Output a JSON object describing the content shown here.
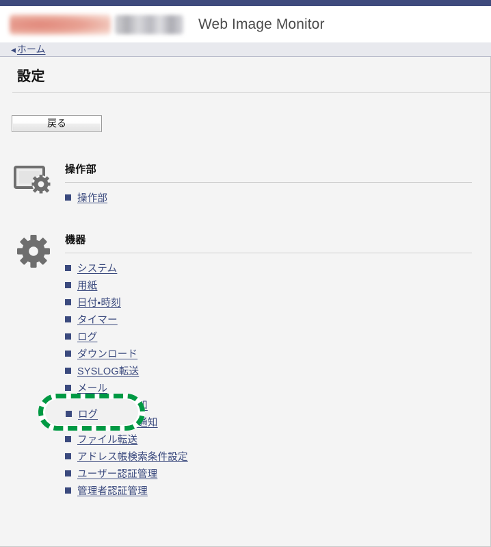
{
  "header": {
    "app_title": "Web Image Monitor",
    "logo_alt": "redacted-brand-logo",
    "topbar_color": "#3f4b7d"
  },
  "breadcrumb": {
    "arrow": "◀",
    "home_label": "ホーム"
  },
  "page": {
    "title": "設定"
  },
  "toolbar": {
    "back_label": "戻る"
  },
  "sections": [
    {
      "id": "operation-panel",
      "title": "操作部",
      "icon": "monitor-gear-icon",
      "items": [
        {
          "label": "操作部"
        }
      ]
    },
    {
      "id": "device",
      "title": "機器",
      "icon": "gear-icon",
      "items": [
        {
          "label": "システム"
        },
        {
          "label": "用紙"
        },
        {
          "label": "日付・時刻"
        },
        {
          "label": "タイマー",
          "obscured": true
        },
        {
          "label": "ログ",
          "highlighted": true
        },
        {
          "label": "ダウンロード",
          "obscured": true
        },
        {
          "label": "SYSLOG転送"
        },
        {
          "label": "メール"
        },
        {
          "label": "自動メール通知"
        },
        {
          "label": "要求時メール通知"
        },
        {
          "label": "ファイル転送"
        },
        {
          "label": "アドレス帳検索条件設定"
        },
        {
          "label": "ユーザー認証管理"
        },
        {
          "label": "管理者認証管理"
        }
      ]
    }
  ],
  "annotation": {
    "target_label": "ログ",
    "color": "#009943",
    "style": "dashed-rounded-rectangle"
  },
  "colors": {
    "link": "#3b4a7e",
    "bullet": "#3b4a7e",
    "content_bg": "#f4f4f4",
    "breadcrumb_bg": "#e8e9ee"
  }
}
